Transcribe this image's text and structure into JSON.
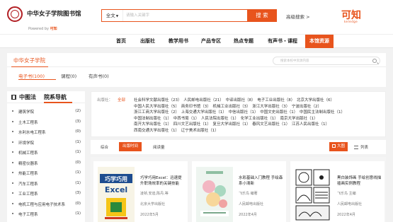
{
  "header": {
    "library_title": "中华女子学院图书馆",
    "powered_prefix": "Powered by",
    "powered_brand": "可知",
    "search_scope": "全文",
    "search_placeholder": "请输入关键字",
    "search_button": "搜 索",
    "advanced_search": "高级搜索 >",
    "brand_name": "可知",
    "brand_sub": "keledge"
  },
  "nav": {
    "items": [
      "首页",
      "出版社",
      "教学用书",
      "产品专区",
      "热点专题",
      "有声书・课程",
      "本馆资源"
    ],
    "active_index": 6
  },
  "school": {
    "tab": "中华女子学院",
    "search_placeholder": "搜索本校中资源内容"
  },
  "type_tabs": [
    "电子书(100)",
    "课程(0)",
    "有声书(0)"
  ],
  "sidebar": {
    "tab_zhongtu": "中图法",
    "tab_yuanxi": "院系导航",
    "items": [
      {
        "label": "建筑学院",
        "count": "(2)"
      },
      {
        "label": "土木工程系",
        "count": "(3)"
      },
      {
        "label": "水利水电工程系",
        "count": "(0)"
      },
      {
        "label": "环境学院",
        "count": "(1)"
      },
      {
        "label": "机械工程系",
        "count": "(1)"
      },
      {
        "label": "精密仪器系",
        "count": "(0)"
      },
      {
        "label": "热能工程系",
        "count": "(1)"
      },
      {
        "label": "汽车工程系",
        "count": "(1)"
      },
      {
        "label": "工业工程系",
        "count": "(3)"
      },
      {
        "label": "电机工程与应用电子技术系",
        "count": "(0)"
      },
      {
        "label": "电子工程系",
        "count": "(1)"
      }
    ]
  },
  "filter": {
    "label": "出版社：",
    "all": "全部",
    "rows": [
      "社会科学文献出版社（23）　人民邮电出版社（21）　中译出版社（8）　电子工业出版社（8）　北京大学出版社（6）",
      "中国人民大学出版社（5）　商务印书馆（3）　机械工业出版社（3）　浙江大学出版社（3）　宁波出版社（2）",
      "浙江工商大学出版社（2）　上海交通大学出版社（1）　中信出版社（1）　中国文史出版社（1）　中国民主法制出版社（1）",
      "中国法制出版社（1）　中西书局（1）　人民法院出版社（1）　化学工业出版社（1）　南京大学出版社（1）",
      "南开大学出版社（1）　四川文艺出版社（1）　复旦大学出版社（1）　春风文艺出版社（1）　江苏人民出版社（1）",
      "西南交通大学出版社（1）　辽宁美术出版社（1）"
    ]
  },
  "sort": {
    "options": [
      "综合",
      "出版时间",
      "阅读量"
    ],
    "active_index": 1,
    "view_grid": "大图",
    "view_list": "列表"
  },
  "books": [
    {
      "title": "巧学巧用Excel：迅速提升职场效率的关键技能",
      "author": "凌祯,安迪,陈丹,等",
      "publisher": "北京大学出版社",
      "date": "2022年5月",
      "cover_text": "巧学巧用 Excel"
    },
    {
      "title": "水彩基础入门教程 手绘森系小清新",
      "author": "飞乐鸟 编著",
      "publisher": "人民邮电出版社",
      "date": "2022年4月",
      "cover_text": "水彩基础入门"
    },
    {
      "title": "黑白装饰画 手绘创意线描插画实例教程",
      "author": "飞乐鸟 主编",
      "publisher": "人民邮电出版社",
      "date": "2022年4月",
      "cover_text": "黑白装饰画"
    }
  ]
}
